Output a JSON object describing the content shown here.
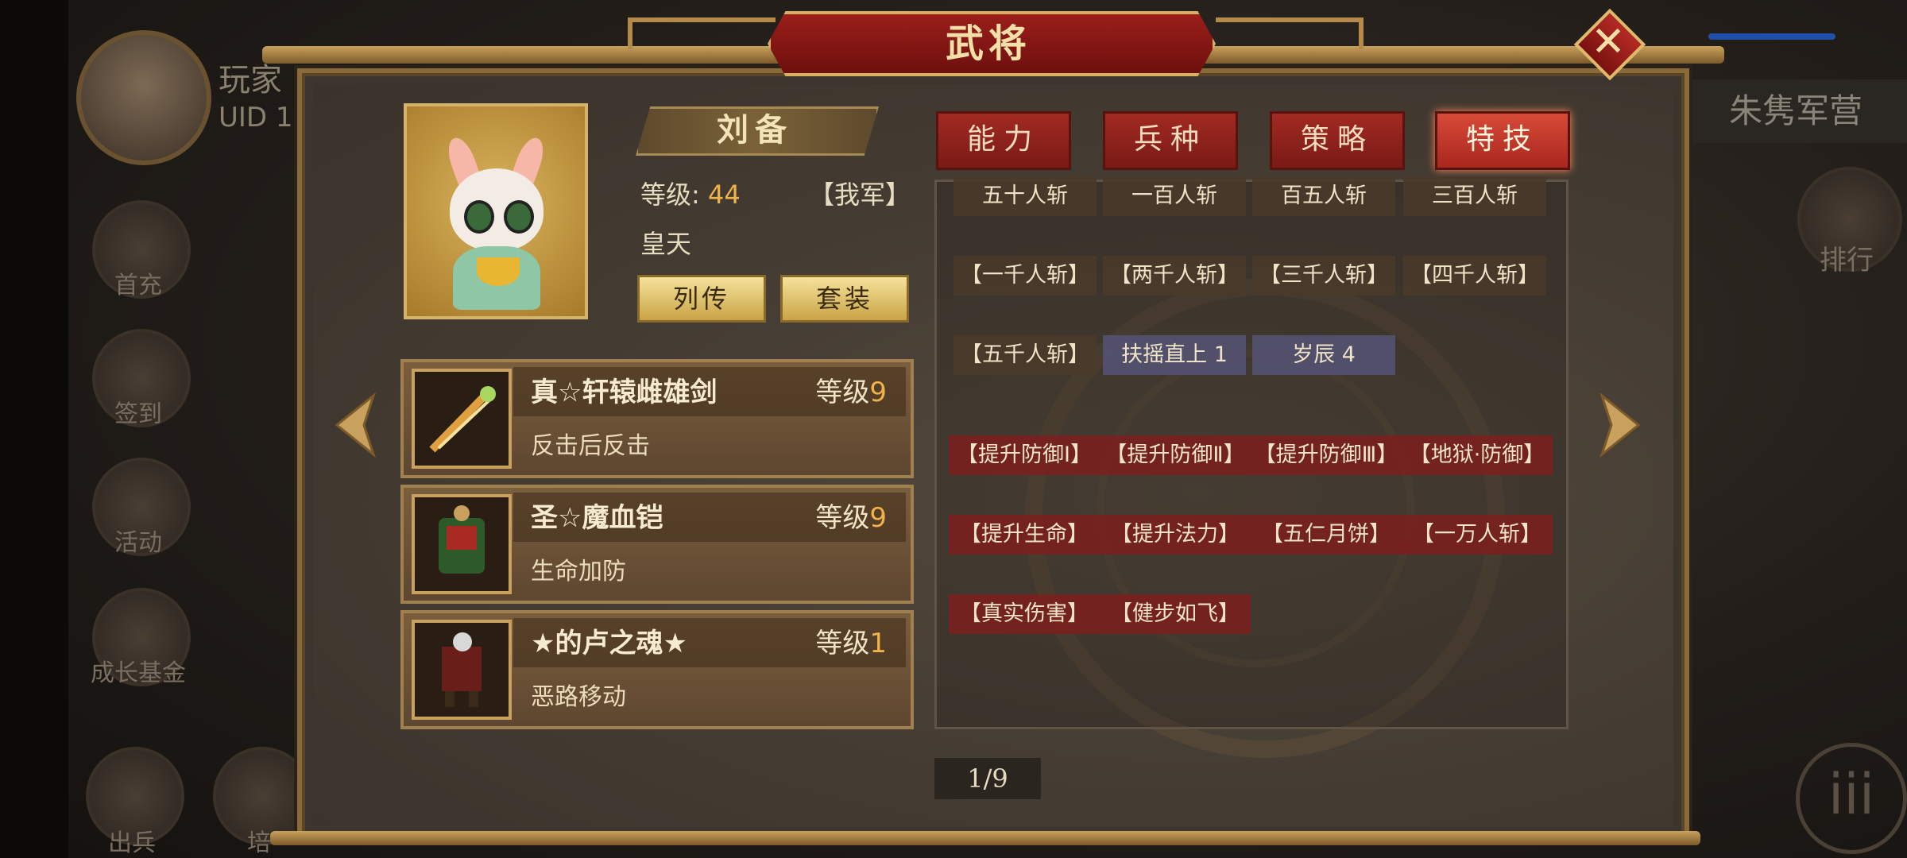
{
  "background": {
    "player_name": "玩家",
    "uid_text": "UID 1",
    "side_icons": [
      "首充",
      "签到",
      "活动",
      "成长基金",
      "出兵",
      "培"
    ],
    "camp_label": "朱隽军营",
    "rank_label": "排行"
  },
  "dialog": {
    "title": "武将",
    "close_icon": "close-icon"
  },
  "hero": {
    "name": "刘备",
    "level_label": "等级:",
    "level_value": "44",
    "faction": "【我军】",
    "title": "皇天",
    "biography_button": "列传",
    "set_button": "套装"
  },
  "equipment": [
    {
      "name": "真☆轩辕雌雄剑",
      "level_label": "等级",
      "level": "9",
      "effect": "反击后反击",
      "icon": "sword-icon"
    },
    {
      "name": "圣☆魔血铠",
      "level_label": "等级",
      "level": "9",
      "effect": "生命加防",
      "icon": "armor-icon"
    },
    {
      "name": "★的卢之魂★",
      "level_label": "等级",
      "level": "1",
      "effect": "恶路移动",
      "icon": "horse-icon"
    }
  ],
  "tabs": [
    {
      "label": "能力",
      "active": false
    },
    {
      "label": "兵种",
      "active": false
    },
    {
      "label": "策略",
      "active": false
    },
    {
      "label": "特技",
      "active": true
    }
  ],
  "skills": [
    {
      "label": "五十人斩",
      "style": "brown"
    },
    {
      "label": "一百人斩",
      "style": "brown"
    },
    {
      "label": "百五人斩",
      "style": "brown"
    },
    {
      "label": "三百人斩",
      "style": "brown"
    },
    {
      "label": "【一千人斩】",
      "style": "brown"
    },
    {
      "label": "【两千人斩】",
      "style": "brown"
    },
    {
      "label": "【三千人斩】",
      "style": "brown"
    },
    {
      "label": "【四千人斩】",
      "style": "brown"
    },
    {
      "label": "【五千人斩】",
      "style": "brown"
    },
    {
      "label": "扶摇直上 1",
      "style": "blue"
    },
    {
      "label": "岁辰 4",
      "style": "blue"
    },
    {
      "label": "【提升防御Ⅰ】",
      "style": "red"
    },
    {
      "label": "【提升防御Ⅱ】",
      "style": "red"
    },
    {
      "label": "【提升防御Ⅲ】",
      "style": "red"
    },
    {
      "label": "【地狱·防御】",
      "style": "red"
    },
    {
      "label": "【提升生命】",
      "style": "red"
    },
    {
      "label": "【提升法力】",
      "style": "red"
    },
    {
      "label": "【五仁月饼】",
      "style": "red"
    },
    {
      "label": "【一万人斩】",
      "style": "red"
    },
    {
      "label": "【真实伤害】",
      "style": "red"
    },
    {
      "label": "【健步如飞】",
      "style": "red"
    }
  ],
  "pagination": {
    "text": "1/9"
  },
  "colors": {
    "accent_red": "#a8271f",
    "gold": "#f0b34a",
    "panel": "#3c352e"
  }
}
